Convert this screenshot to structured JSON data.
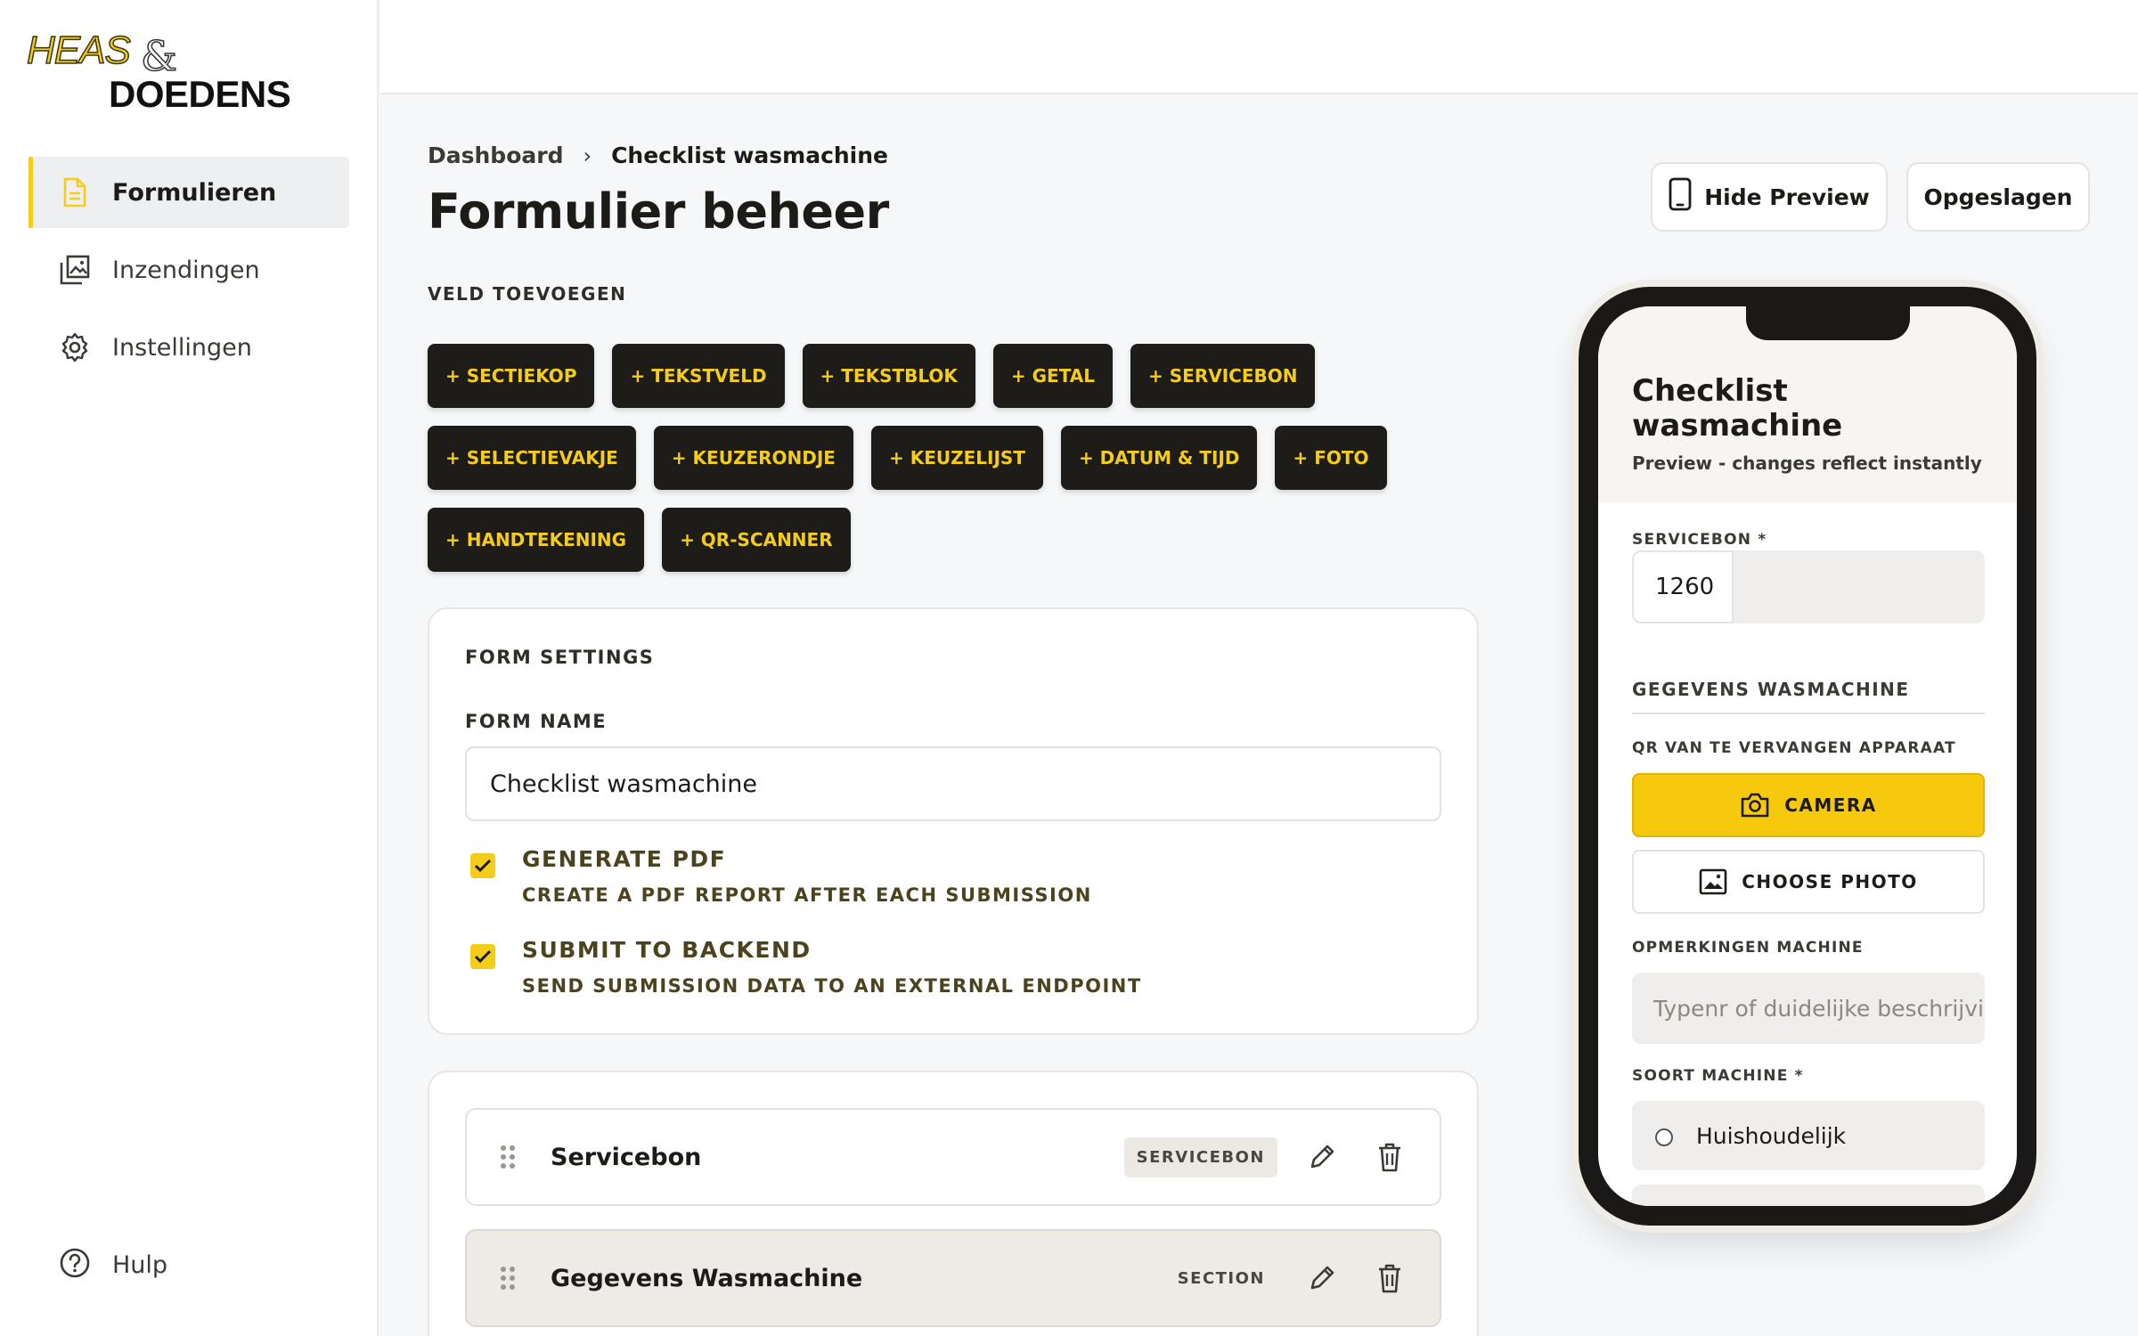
{
  "brand": {
    "line1": "HEAS",
    "amp": "&",
    "line2": "DOEDENS"
  },
  "sidebar": {
    "items": [
      {
        "label": "Formulieren",
        "icon": "document-icon",
        "active": true
      },
      {
        "label": "Inzendingen",
        "icon": "gallery-icon",
        "active": false
      },
      {
        "label": "Instellingen",
        "icon": "gear-icon",
        "active": false
      }
    ],
    "help_label": "Hulp"
  },
  "breadcrumb": {
    "root": "Dashboard",
    "separator": "›",
    "current": "Checklist wasmachine"
  },
  "page": {
    "title": "Formulier beheer",
    "add_field_label": "VELD TOEVOEGEN"
  },
  "header_buttons": {
    "preview": "Hide Preview",
    "saved": "Opgeslagen"
  },
  "field_types": [
    [
      "+ SECTIEKOP",
      "+ TEKSTVELD",
      "+ TEKSTBLOK",
      "+ GETAL",
      "+ SERVICEBON"
    ],
    [
      "+ SELECTIEVAKJE",
      "+ KEUZERONDJE",
      "+ KEUZELIJST",
      "+ DATUM & TIJD",
      "+ FOTO"
    ],
    [
      "+ HANDTEKENING",
      "+ QR-SCANNER"
    ]
  ],
  "form_settings": {
    "heading": "FORM SETTINGS",
    "name_label": "FORM NAME",
    "name_value": "Checklist wasmachine",
    "options": [
      {
        "title": "GENERATE PDF",
        "desc": "CREATE A PDF REPORT AFTER EACH SUBMISSION",
        "checked": true
      },
      {
        "title": "SUBMIT TO BACKEND",
        "desc": "SEND SUBMISSION DATA TO AN EXTERNAL ENDPOINT",
        "checked": true
      }
    ]
  },
  "fields": [
    {
      "name": "Servicebon",
      "type": "SERVICEBON"
    },
    {
      "name": "Gegevens Wasmachine",
      "type": "SECTION"
    }
  ],
  "preview": {
    "title": "Checklist wasmachine",
    "subtitle": "Preview - changes reflect instantly",
    "servicebon_label": "SERVICEBON *",
    "servicebon_value": "1260",
    "section_title": "GEGEVENS WASMACHINE",
    "qr_label": "QR VAN TE VERVANGEN APPARAAT",
    "camera_button": "CAMERA",
    "choose_photo_button": "CHOOSE PHOTO",
    "remarks_label": "OPMERKINGEN MACHINE",
    "remarks_placeholder": "Typenr of duidelijke beschrijving",
    "machine_type_label": "SOORT MACHINE *",
    "machine_options": [
      "Huishoudelijk"
    ]
  },
  "colors": {
    "accent": "#f4cc1a",
    "chip_bg": "#1e1c19",
    "text": "#1c1b18"
  }
}
